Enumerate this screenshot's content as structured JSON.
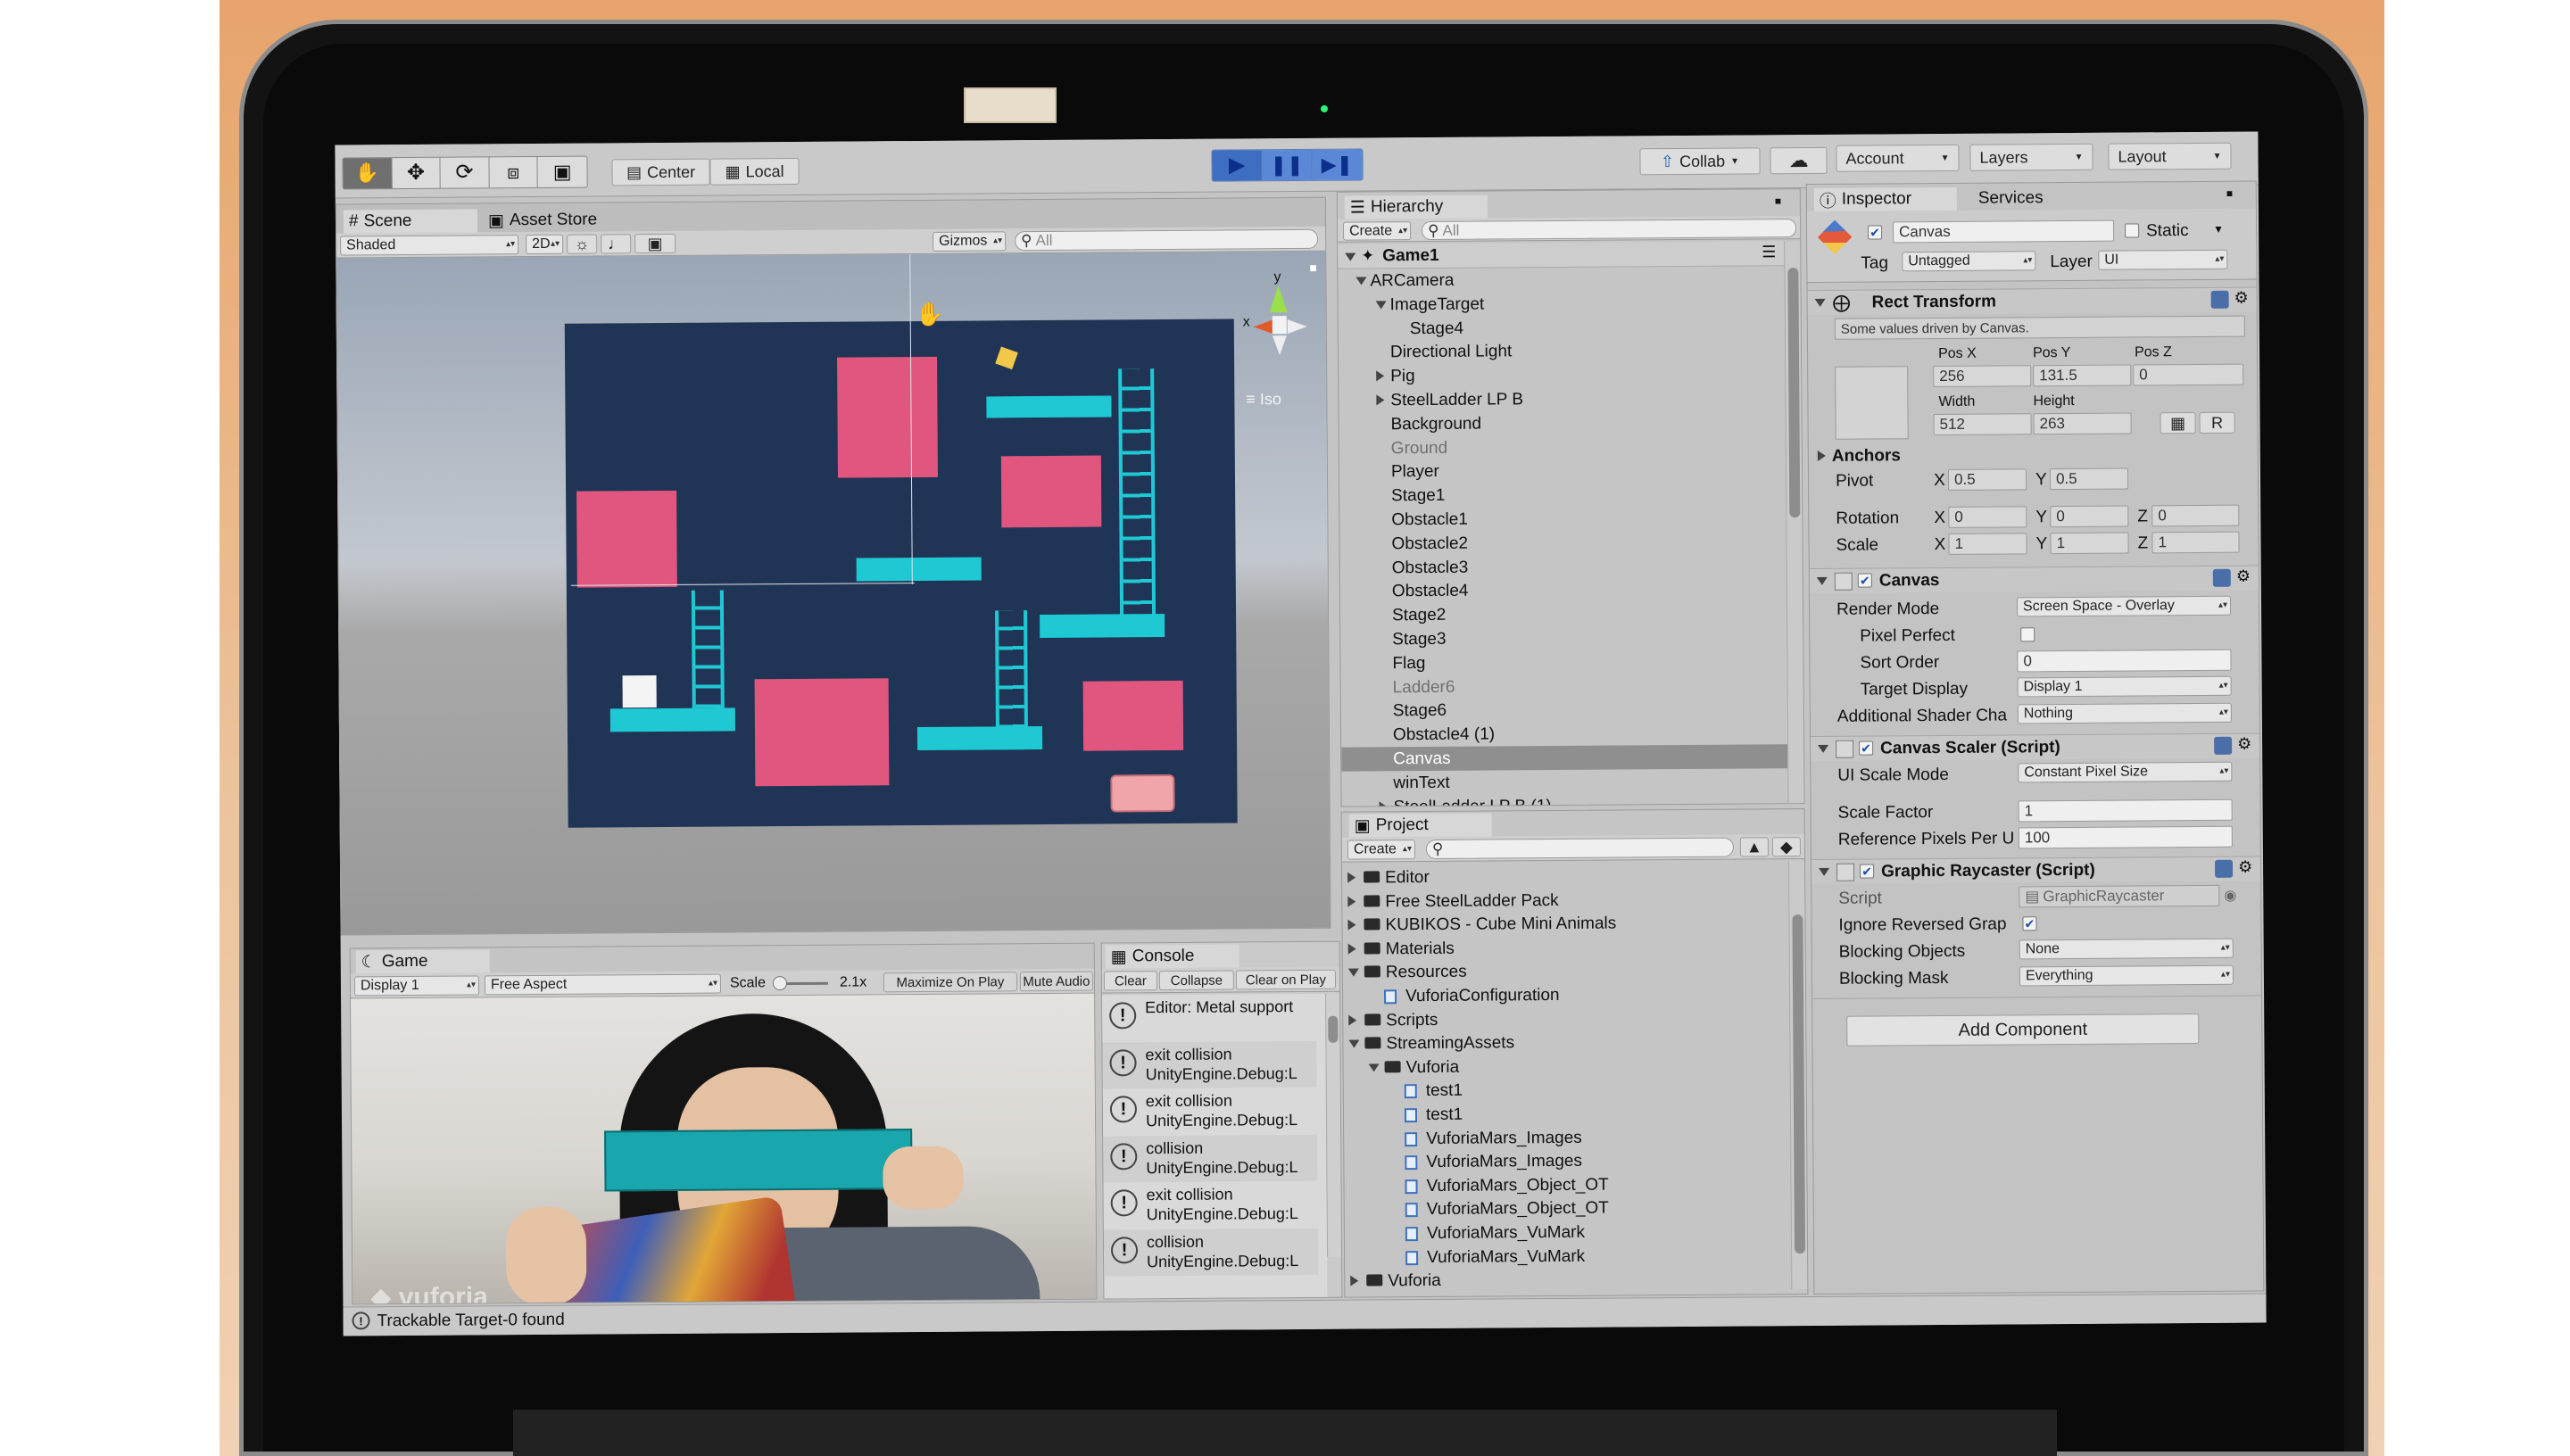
{
  "toolbar": {
    "center_label": "Center",
    "local_label": "Local",
    "collab_label": "Collab",
    "account_label": "Account",
    "layers_label": "Layers",
    "layout_label": "Layout"
  },
  "scene": {
    "tab_scene": "Scene",
    "tab_asset_store": "Asset Store",
    "shading": "Shaded",
    "mode_2d": "2D",
    "gizmos": "Gizmos",
    "search_placeholder": "All",
    "gizmo_y": "y",
    "gizmo_x": "x",
    "iso": "Iso"
  },
  "game": {
    "tab": "Game",
    "display": "Display 1",
    "aspect": "Free Aspect",
    "scale_label": "Scale",
    "scale_value": "2.1x",
    "maximize": "Maximize On Play",
    "mute": "Mute Audio",
    "watermark": "vuforia"
  },
  "console": {
    "tab": "Console",
    "clear": "Clear",
    "collapse": "Collapse",
    "clear_on_play": "Clear on Play",
    "entries": [
      {
        "line1": "Editor: Metal support",
        "line2": ""
      },
      {
        "line1": "exit collision",
        "line2": "UnityEngine.Debug:L"
      },
      {
        "line1": "exit collision",
        "line2": "UnityEngine.Debug:L"
      },
      {
        "line1": "collision",
        "line2": "UnityEngine.Debug:L"
      },
      {
        "line1": "exit collision",
        "line2": "UnityEngine.Debug:L"
      },
      {
        "line1": "collision",
        "line2": "UnityEngine.Debug:L"
      }
    ]
  },
  "hierarchy": {
    "tab": "Hierarchy",
    "create": "Create",
    "search_placeholder": "All",
    "scene_name": "Game1",
    "items": [
      {
        "label": "ARCamera",
        "indent": 1,
        "arrow": "open"
      },
      {
        "label": "ImageTarget",
        "indent": 2,
        "arrow": "open"
      },
      {
        "label": "Stage4",
        "indent": 3,
        "arrow": "none"
      },
      {
        "label": "Directional Light",
        "indent": 2,
        "arrow": "none"
      },
      {
        "label": "Pig",
        "indent": 2,
        "arrow": "closed"
      },
      {
        "label": "SteelLadder LP B",
        "indent": 2,
        "arrow": "closed"
      },
      {
        "label": "Background",
        "indent": 2,
        "arrow": "none"
      },
      {
        "label": "Ground",
        "indent": 2,
        "arrow": "none",
        "dim": true
      },
      {
        "label": "Player",
        "indent": 2,
        "arrow": "none"
      },
      {
        "label": "Stage1",
        "indent": 2,
        "arrow": "none"
      },
      {
        "label": "Obstacle1",
        "indent": 2,
        "arrow": "none"
      },
      {
        "label": "Obstacle2",
        "indent": 2,
        "arrow": "none"
      },
      {
        "label": "Obstacle3",
        "indent": 2,
        "arrow": "none"
      },
      {
        "label": "Obstacle4",
        "indent": 2,
        "arrow": "none"
      },
      {
        "label": "Stage2",
        "indent": 2,
        "arrow": "none"
      },
      {
        "label": "Stage3",
        "indent": 2,
        "arrow": "none"
      },
      {
        "label": "Flag",
        "indent": 2,
        "arrow": "none"
      },
      {
        "label": "Ladder6",
        "indent": 2,
        "arrow": "none",
        "dim": true
      },
      {
        "label": "Stage6",
        "indent": 2,
        "arrow": "none"
      },
      {
        "label": "Obstacle4 (1)",
        "indent": 2,
        "arrow": "none"
      },
      {
        "label": "Canvas",
        "indent": 2,
        "arrow": "none",
        "selected": true
      },
      {
        "label": "winText",
        "indent": 2,
        "arrow": "none"
      },
      {
        "label": "SteelLadder LP B (1)",
        "indent": 2,
        "arrow": "closed"
      }
    ]
  },
  "project": {
    "tab": "Project",
    "create": "Create",
    "items": [
      {
        "label": "Editor",
        "indent": 0,
        "arrow": "closed",
        "kind": "folder"
      },
      {
        "label": "Free SteelLadder Pack",
        "indent": 0,
        "arrow": "closed",
        "kind": "folder"
      },
      {
        "label": "KUBIKOS - Cube Mini Animals",
        "indent": 0,
        "arrow": "closed",
        "kind": "folder"
      },
      {
        "label": "Materials",
        "indent": 0,
        "arrow": "closed",
        "kind": "folder"
      },
      {
        "label": "Resources",
        "indent": 0,
        "arrow": "open",
        "kind": "folder"
      },
      {
        "label": "VuforiaConfiguration",
        "indent": 1,
        "arrow": "none",
        "kind": "asset"
      },
      {
        "label": "Scripts",
        "indent": 0,
        "arrow": "closed",
        "kind": "folder"
      },
      {
        "label": "StreamingAssets",
        "indent": 0,
        "arrow": "open",
        "kind": "folder"
      },
      {
        "label": "Vuforia",
        "indent": 1,
        "arrow": "open",
        "kind": "folder"
      },
      {
        "label": "test1",
        "indent": 2,
        "arrow": "none",
        "kind": "asset"
      },
      {
        "label": "test1",
        "indent": 2,
        "arrow": "none",
        "kind": "asset"
      },
      {
        "label": "VuforiaMars_Images",
        "indent": 2,
        "arrow": "none",
        "kind": "asset"
      },
      {
        "label": "VuforiaMars_Images",
        "indent": 2,
        "arrow": "none",
        "kind": "asset"
      },
      {
        "label": "VuforiaMars_Object_OT",
        "indent": 2,
        "arrow": "none",
        "kind": "asset"
      },
      {
        "label": "VuforiaMars_Object_OT",
        "indent": 2,
        "arrow": "none",
        "kind": "asset"
      },
      {
        "label": "VuforiaMars_VuMark",
        "indent": 2,
        "arrow": "none",
        "kind": "asset"
      },
      {
        "label": "VuforiaMars_VuMark",
        "indent": 2,
        "arrow": "none",
        "kind": "asset"
      },
      {
        "label": "Vuforia",
        "indent": 0,
        "arrow": "closed",
        "kind": "folder"
      }
    ]
  },
  "inspector": {
    "tab": "Inspector",
    "tab_services": "Services",
    "object_name": "Canvas",
    "static_label": "Static",
    "tag_label": "Tag",
    "tag_value": "Untagged",
    "layer_label": "Layer",
    "layer_value": "UI",
    "rect": {
      "title": "Rect Transform",
      "note": "Some values driven by Canvas.",
      "posx_label": "Pos X",
      "posy_label": "Pos Y",
      "posz_label": "Pos Z",
      "posx": "256",
      "posy": "131.5",
      "posz": "0",
      "width_label": "Width",
      "height_label": "Height",
      "width": "512",
      "height": "263",
      "r_btn": "R",
      "anchors": "Anchors",
      "pivot": "Pivot",
      "pivot_x": "0.5",
      "pivot_y": "0.5",
      "rotation": "Rotation",
      "rot_x": "0",
      "rot_y": "0",
      "rot_z": "0",
      "scale": "Scale",
      "scale_x": "1",
      "scale_y": "1",
      "scale_z": "1",
      "x": "X",
      "y": "Y",
      "z": "Z"
    },
    "canvas": {
      "title": "Canvas",
      "render_mode_label": "Render Mode",
      "render_mode": "Screen Space - Overlay",
      "pixel_perfect": "Pixel Perfect",
      "sort_order_label": "Sort Order",
      "sort_order": "0",
      "target_display_label": "Target Display",
      "target_display": "Display 1",
      "shader_label": "Additional Shader Cha",
      "shader_value": "Nothing"
    },
    "scaler": {
      "title": "Canvas Scaler (Script)",
      "scale_mode_label": "UI Scale Mode",
      "scale_mode": "Constant Pixel Size",
      "scale_factor_label": "Scale Factor",
      "scale_factor": "1",
      "ref_label": "Reference Pixels Per U",
      "ref_value": "100"
    },
    "raycaster": {
      "title": "Graphic Raycaster (Script)",
      "script_label": "Script",
      "script_value": "GraphicRaycaster",
      "ignore_label": "Ignore Reversed Grap",
      "blocking_objects_label": "Blocking Objects",
      "blocking_objects": "None",
      "blocking_mask_label": "Blocking Mask",
      "blocking_mask": "Everything"
    },
    "add_component": "Add Component"
  },
  "status": {
    "text": "Trackable Target-0 found"
  },
  "colors": {
    "level_bg": "#203555",
    "pink": "#e0567e",
    "cyan": "#1fc9d3",
    "selection": "#8f8f8f"
  }
}
